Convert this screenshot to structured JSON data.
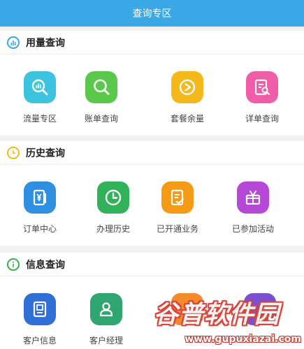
{
  "header": {
    "title": "查询专区"
  },
  "sections": {
    "usage": {
      "title": "用量查询",
      "icon_color": "#3aa7e6",
      "items": [
        {
          "label": "流量专区",
          "icon": "chart-search-icon",
          "color": "#3bc3e0"
        },
        {
          "label": "账单查询",
          "icon": "magnifier-icon",
          "color": "#5ac84a"
        },
        {
          "label": "套餐余量",
          "icon": "circle-play-icon",
          "color": "#f5b81a"
        },
        {
          "label": "详单查询",
          "icon": "document-search-icon",
          "color": "#ef5ca8"
        }
      ]
    },
    "history": {
      "title": "历史查询",
      "icon_color": "#f5b81a",
      "items": [
        {
          "label": "订单中心",
          "icon": "yuan-receipt-icon",
          "color": "#2f8fe0"
        },
        {
          "label": "办理历史",
          "icon": "clock-icon",
          "color": "#31b158"
        },
        {
          "label": "已开通业务",
          "icon": "checked-list-icon",
          "color": "#f59a14"
        },
        {
          "label": "已参加活动",
          "icon": "gift-icon",
          "color": "#b548d6"
        }
      ]
    },
    "info": {
      "title": "信息查询",
      "icon_color": "#35b04a",
      "items": [
        {
          "label": "客户信息",
          "icon": "id-card-icon",
          "color": "#2f6fd6"
        },
        {
          "label": "客户经理",
          "icon": "person-icon",
          "color": "#2fa572"
        },
        {
          "label": "",
          "icon": "partially-hidden-icon",
          "color": "#f58a2a"
        },
        {
          "label": "",
          "icon": "partially-hidden-icon",
          "color": "#7c4fd0"
        }
      ]
    }
  },
  "watermark": {
    "text": "谷普软件园",
    "url": "www.gupuxiazai.com"
  }
}
